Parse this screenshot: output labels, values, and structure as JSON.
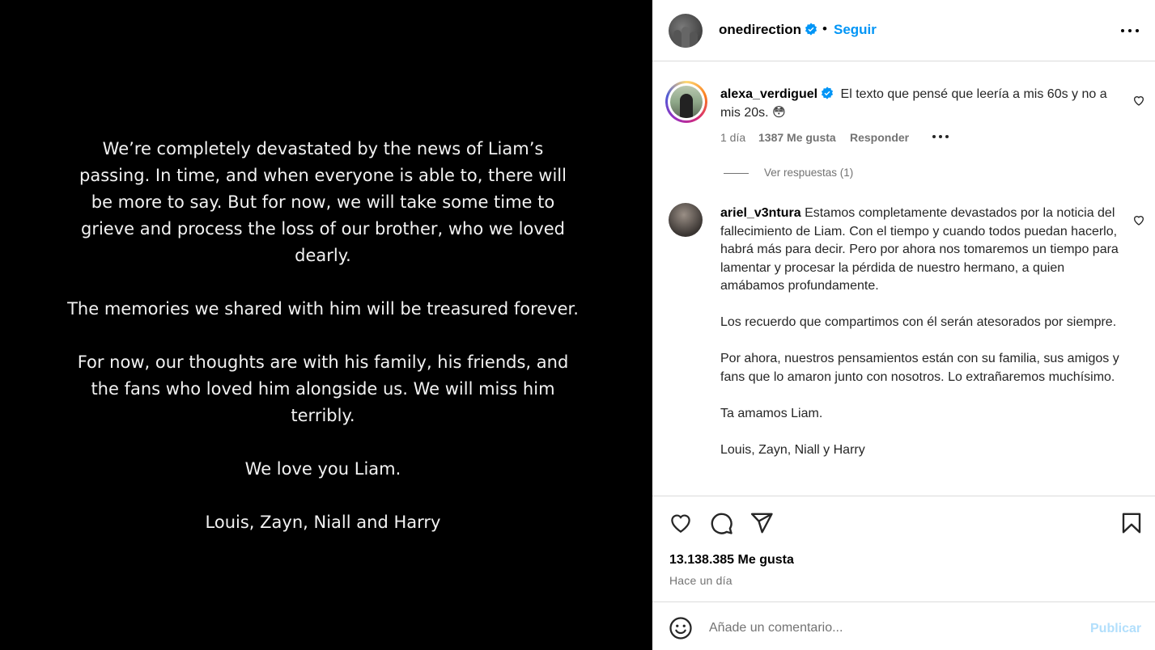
{
  "post_image": {
    "paragraphs": [
      "We’re completely devastated by the news of Liam’s passing. In time, and when everyone is able to, there will be more to say. But for now, we will take some time to grieve and process the loss of our brother, who we loved dearly.",
      "The memories we shared with him will be treasured forever.",
      "For now, our thoughts are with his family, his friends, and the fans who loved him alongside us. We will miss him terribly.",
      "We love you Liam.",
      "Louis, Zayn, Niall and Harry"
    ]
  },
  "header": {
    "username": "onedirection",
    "dot": "•",
    "follow_label": "Seguir"
  },
  "comments": [
    {
      "username": "alexa_verdiguel",
      "text": "El texto que pensé que leería a mis 60s y no a mis 20s. 😳",
      "time": "1 día",
      "likes": "1387 Me gusta",
      "reply_label": "Responder",
      "view_replies": "Ver respuestas (1)"
    },
    {
      "username": "ariel_v3ntura",
      "text_p1": "Estamos completamente devastados por la noticia del fallecimiento de Liam. Con el tiempo y cuando todos puedan hacerlo, habrá más para decir. Pero por ahora nos tomaremos un tiempo para lamentar y procesar la pérdida de nuestro hermano, a quien amábamos profundamente.",
      "text_p2": "Los recuerdo que compartimos con él serán atesorados por siempre.",
      "text_p3": "Por ahora, nuestros pensamientos están con su familia, sus amigos y fans que lo amaron junto con nosotros. Lo extrañaremos muchísimo.",
      "text_p4": "Ta amamos Liam.",
      "text_p5": "Louis, Zayn, Niall y Harry"
    }
  ],
  "footer": {
    "likes_count": "13.138.385 Me gusta",
    "time_ago": "Hace un día"
  },
  "add_comment": {
    "placeholder": "Añade un comentario...",
    "publish_label": "Publicar"
  },
  "colors": {
    "accent": "#0095f6",
    "publish_disabled": "#b2dffc",
    "muted": "#737373",
    "border": "#dbdbdb",
    "image_bg": "#000000"
  },
  "icons": [
    "verified-badge-icon",
    "more-options-icon",
    "heart-icon",
    "comment-icon",
    "share-icon",
    "save-icon",
    "emoji-icon"
  ]
}
